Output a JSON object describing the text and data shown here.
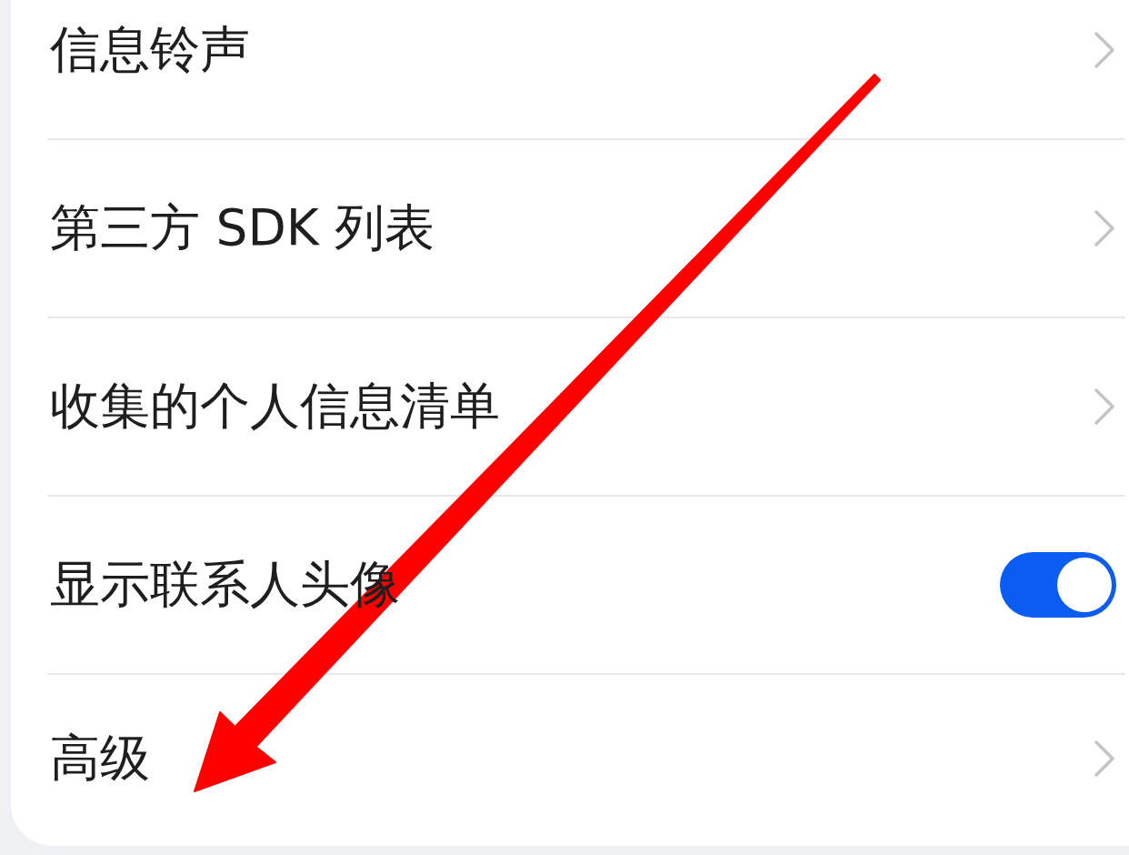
{
  "settings_list": {
    "items": [
      {
        "kind": "link",
        "label": "信息铃声"
      },
      {
        "kind": "link",
        "label": "第三方 SDK 列表"
      },
      {
        "kind": "link",
        "label": "收集的个人信息清单"
      },
      {
        "kind": "toggle",
        "label": "显示联系人头像",
        "on": true
      },
      {
        "kind": "link",
        "label": "高级"
      }
    ]
  }
}
